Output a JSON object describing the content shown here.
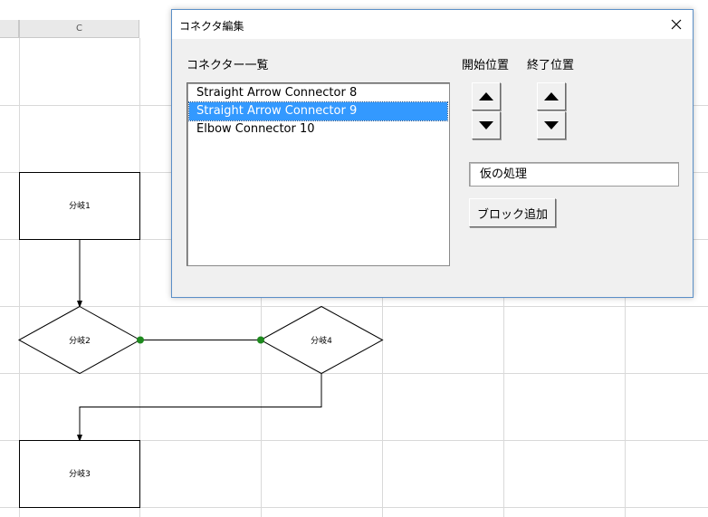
{
  "sheet": {
    "column_label_c": "C",
    "shapes": {
      "branch1": "分岐1",
      "branch2": "分岐2",
      "branch3": "分岐3",
      "branch4": "分岐4"
    },
    "colors": {
      "grid": "#d9d9d9",
      "connector_point": "#1e8a1e"
    }
  },
  "dialog": {
    "title": "コネクタ編集",
    "list_label": "コネクター一覧",
    "start_label": "開始位置",
    "end_label": "終了位置",
    "connectors": [
      {
        "label": "Straight Arrow Connector 8",
        "selected": false
      },
      {
        "label": "Straight Arrow Connector 9",
        "selected": true
      },
      {
        "label": "Elbow Connector 10",
        "selected": false
      }
    ],
    "text_value": "仮の処理",
    "add_block_label": "ブロック追加",
    "icons": {
      "close": "close-icon",
      "up": "arrow-up-icon",
      "down": "arrow-down-icon"
    },
    "colors": {
      "selection": "#3399ff",
      "border": "#5b8fc7"
    }
  }
}
